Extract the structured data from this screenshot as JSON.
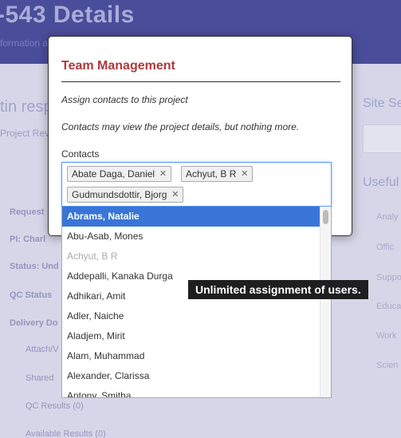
{
  "background": {
    "title": "-543 Details",
    "subtitle": "formation about your project",
    "heading_left": "tin respo",
    "heading_right": "Site Sea",
    "heading_right2": "Useful li",
    "intro_line": "Project Reviewer, Project Contact and ",
    "labels": [
      "Request",
      "PI: Charl",
      "Status: Und",
      "QC Status",
      "Delivery Do"
    ],
    "links": [
      "Attach/V",
      "Shared",
      "QC Results (0)",
      "Available Results (0)"
    ],
    "right_items": [
      "Analy",
      "Offic",
      "Suppo",
      "Educa",
      "Work",
      "Scien"
    ]
  },
  "modal": {
    "title": "Team Management",
    "text1": "Assign contacts to this project",
    "text2": "Contacts may view the project details, but nothing more.",
    "contacts_label": "Contacts",
    "selected": [
      "Abate Daga, Daniel",
      "Achyut, B R",
      "Gudmundsdottir, Bjorg"
    ],
    "remove_glyph": "✕"
  },
  "dropdown": {
    "options": [
      {
        "label": "Abrams, Natalie",
        "state": "highlighted"
      },
      {
        "label": "Abu-Asab, Mones",
        "state": "normal"
      },
      {
        "label": "Achyut, B R",
        "state": "disabled"
      },
      {
        "label": "Addepalli, Kanaka Durga",
        "state": "normal"
      },
      {
        "label": "Adhikari, Amit",
        "state": "normal"
      },
      {
        "label": "Adler, Naiche",
        "state": "normal"
      },
      {
        "label": "Aladjem, Mirit",
        "state": "normal"
      },
      {
        "label": "Alam, Muhammad",
        "state": "normal"
      },
      {
        "label": "Alexander, Clarissa",
        "state": "normal"
      },
      {
        "label": "Antony, Smitha",
        "state": "normal"
      }
    ]
  },
  "banner": {
    "text": "Unlimited assignment of users."
  },
  "colors": {
    "header": "#4a4d9a",
    "modal_title": "#b0383b",
    "highlight": "#3875d7",
    "focus_border": "#5897fb"
  }
}
